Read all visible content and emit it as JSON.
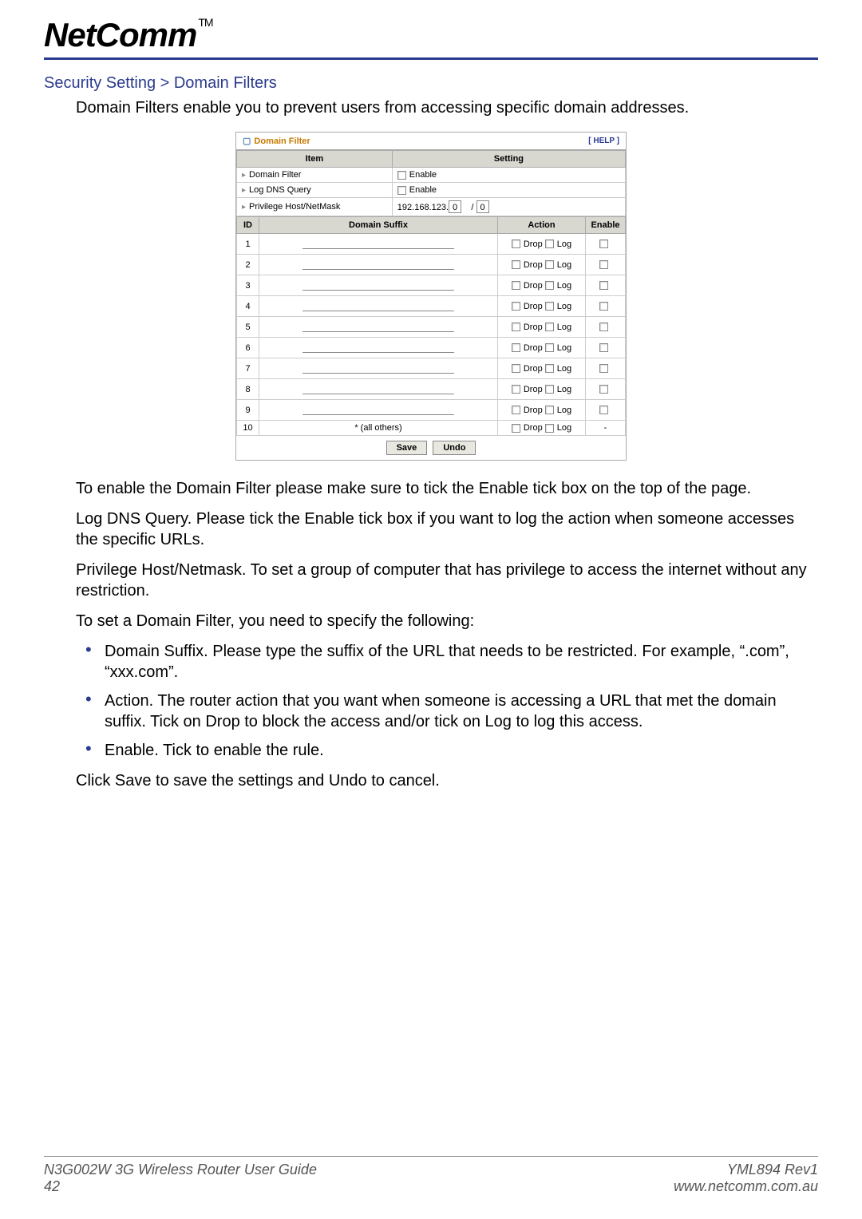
{
  "logo": {
    "text": "NetComm",
    "tm": "TM"
  },
  "breadcrumb": "Security Setting > Domain Filters",
  "intro": "Domain Filters enable you to prevent users from accessing specific domain addresses.",
  "panel": {
    "title": "Domain Filter",
    "help": "[ HELP ]",
    "headers": {
      "item": "Item",
      "setting": "Setting"
    },
    "rows": {
      "domain_filter": {
        "label": "Domain Filter",
        "enable_label": "Enable"
      },
      "log_dns": {
        "label": "Log DNS Query",
        "enable_label": "Enable"
      },
      "priv_host": {
        "label": "Privilege Host/NetMask",
        "ip_prefix": "192.168.123.",
        "octet": "0",
        "sep": "/",
        "mask": "0"
      }
    },
    "rules_headers": {
      "id": "ID",
      "suffix": "Domain Suffix",
      "action": "Action",
      "enable": "Enable"
    },
    "action_labels": {
      "drop": "Drop",
      "log": "Log"
    },
    "rules": [
      {
        "id": "1",
        "suffix": "",
        "all_others": false
      },
      {
        "id": "2",
        "suffix": "",
        "all_others": false
      },
      {
        "id": "3",
        "suffix": "",
        "all_others": false
      },
      {
        "id": "4",
        "suffix": "",
        "all_others": false
      },
      {
        "id": "5",
        "suffix": "",
        "all_others": false
      },
      {
        "id": "6",
        "suffix": "",
        "all_others": false
      },
      {
        "id": "7",
        "suffix": "",
        "all_others": false
      },
      {
        "id": "8",
        "suffix": "",
        "all_others": false
      },
      {
        "id": "9",
        "suffix": "",
        "all_others": false
      },
      {
        "id": "10",
        "suffix": "* (all others)",
        "all_others": true
      }
    ],
    "buttons": {
      "save": "Save",
      "undo": "Undo"
    }
  },
  "body": {
    "p1": "To enable the Domain Filter please make sure to tick the Enable tick box on the top of the page.",
    "p2": "Log DNS Query. Please tick the Enable tick box if you want to log the action when someone accesses the specific URLs.",
    "p3": "Privilege Host/Netmask. To set a group of computer that has privilege to access the internet without any restriction.",
    "p4": "To set a Domain Filter, you need to specify the following:",
    "li1": "Domain Suffix. Please type the suffix of the URL that needs to be restricted. For example, “.com”, “xxx.com”.",
    "li2": "Action. The router action that you want when someone is accessing a URL that met the domain suffix. Tick on Drop to block the access and/or tick on Log to log this access.",
    "li3": "Enable. Tick to enable the rule.",
    "p5": "Click Save to save the settings and Undo to cancel."
  },
  "footer": {
    "guide": "N3G002W 3G Wireless Router User Guide",
    "page": "42",
    "rev": "YML894 Rev1",
    "url": "www.netcomm.com.au"
  }
}
